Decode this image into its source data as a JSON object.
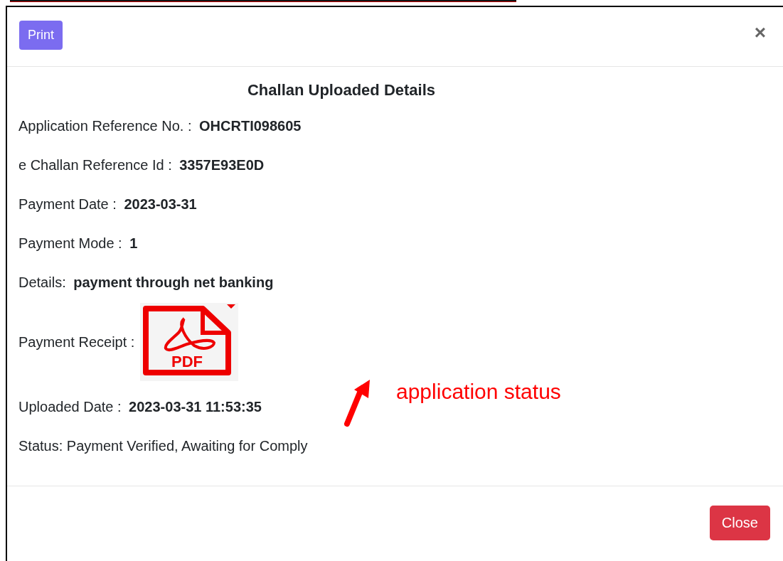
{
  "header": {
    "print_button": "Print",
    "close_icon": "×"
  },
  "title": "Challan Uploaded Details",
  "fields": [
    {
      "kind": "text",
      "label": "Application Reference No. : ",
      "value": "OHCRTI098605"
    },
    {
      "kind": "text",
      "label": "e Challan Reference Id : ",
      "value": "3357E93E0D"
    },
    {
      "kind": "text",
      "label": "Payment Date : ",
      "value": "2023-03-31"
    },
    {
      "kind": "text",
      "label": "Payment Mode : ",
      "value": "1"
    },
    {
      "kind": "text",
      "label": "Details: ",
      "value": "payment through net banking"
    },
    {
      "kind": "file",
      "label": "Payment Receipt : ",
      "value": "PDF"
    },
    {
      "kind": "text",
      "label": "Uploaded Date : ",
      "value": "2023-03-31 11:53:35"
    },
    {
      "kind": "plain",
      "label": "Status: Payment Verified, Awaiting for Comply"
    }
  ],
  "annotation": {
    "text": "application status"
  },
  "footer": {
    "close_button": "Close"
  }
}
